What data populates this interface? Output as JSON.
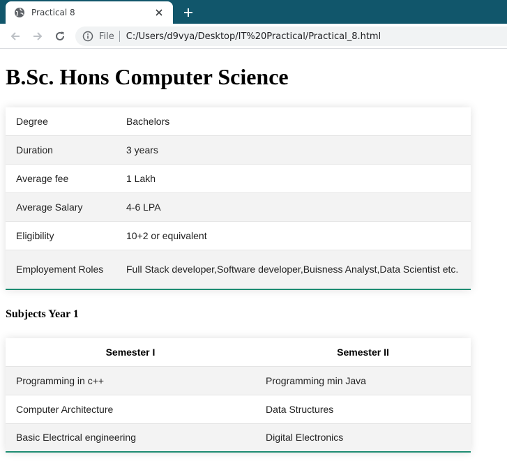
{
  "browser": {
    "tab_title": "Practical 8",
    "address_scheme": "File",
    "address_url": "C:/Users/d9vya/Desktop/IT%20Practical/Practical_8.html",
    "tabbar_color": "#11566b"
  },
  "page": {
    "title": "B.Sc. Hons Computer Science",
    "info_rows": [
      {
        "label": "Degree",
        "value": "Bachelors"
      },
      {
        "label": "Duration",
        "value": "3 years"
      },
      {
        "label": "Average fee",
        "value": "1 Lakh"
      },
      {
        "label": "Average Salary",
        "value": "4-6 LPA"
      },
      {
        "label": "Eligibility",
        "value": "10+2 or equivalent"
      },
      {
        "label": "Employement Roles",
        "value": "Full Stack developer,Software developer,Buisness Analyst,Data Scientist etc."
      }
    ],
    "subjects_heading": "Subjects Year 1",
    "subjects_table": {
      "headers": [
        "Semester I",
        "Semester II"
      ],
      "rows": [
        [
          "Programming in c++",
          "Programming min Java"
        ],
        [
          "Computer Architecture",
          "Data Structures"
        ],
        [
          "Basic Electrical engineering",
          "Digital Electronics"
        ]
      ]
    },
    "accent_color": "#1e8c72"
  }
}
